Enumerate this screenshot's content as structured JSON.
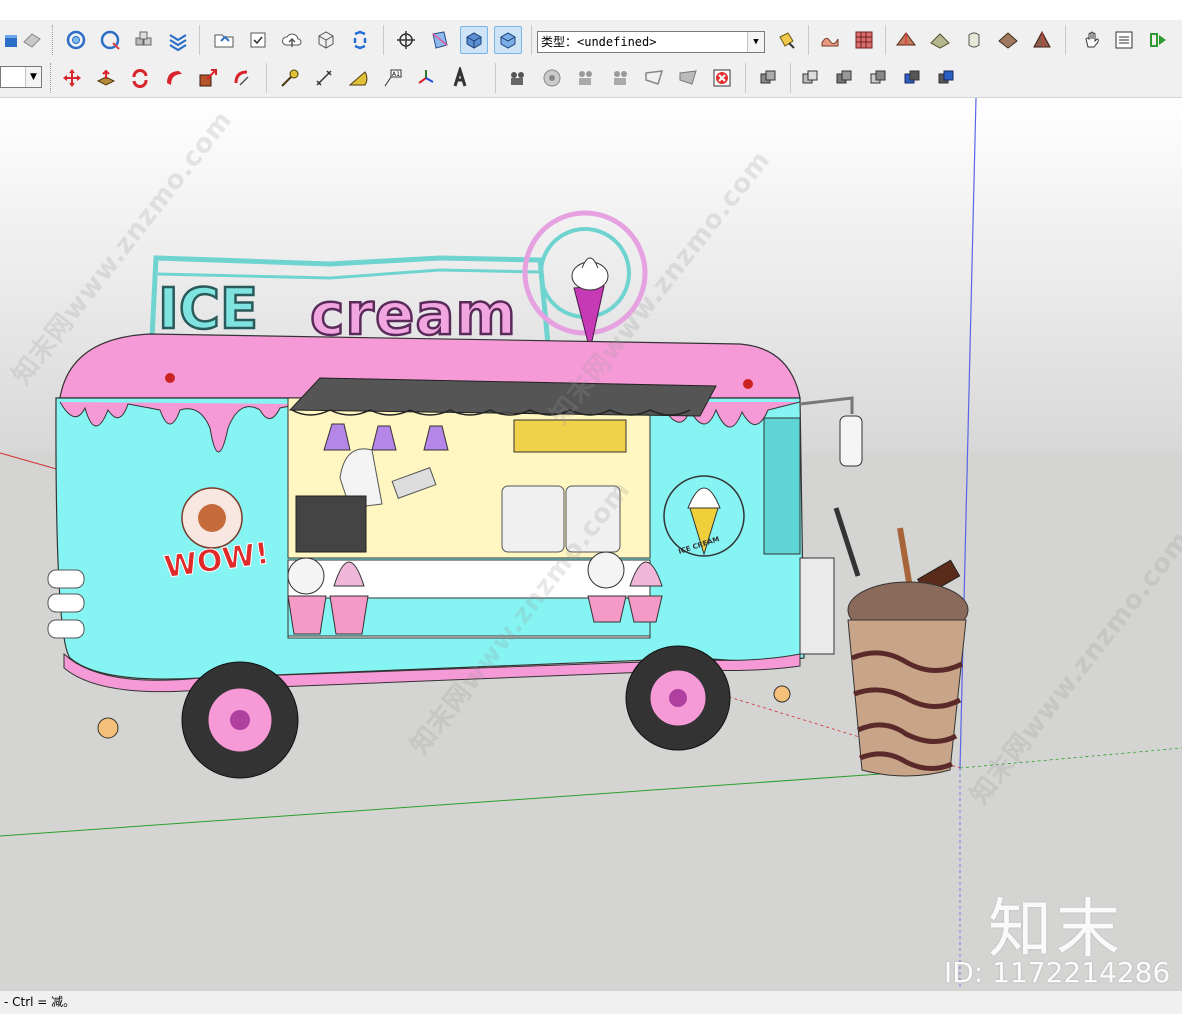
{
  "toolbar": {
    "type_field_value": "类型：<undefined>",
    "row1_icons": [
      "select-face-icon",
      "eraser-icon",
      "orbit-pan-icon",
      "orbit-zoom-icon",
      "components-icon",
      "flip-icon",
      "open-folder-icon",
      "checkbox-icon",
      "cloud-upload-icon",
      "package-icon",
      "extension-icon",
      "move-position-icon",
      "section-box-icon",
      "iso-view-icon",
      "top-view-icon",
      "paint-bucket-icon",
      "grid-tile-icon",
      "sandbox-icon",
      "terrain-icon",
      "stamp-icon",
      "texture-icon",
      "pyramid-icon",
      "hand-icon",
      "list-icon",
      "export-icon"
    ],
    "row2_icons": [
      "move-icon",
      "pushpull-icon",
      "rotate-icon",
      "followme-icon",
      "scale-icon",
      "offset-icon",
      "tape-measure-icon",
      "dimension-icon",
      "protractor-icon",
      "text-icon",
      "axes-icon",
      "3d-text-icon",
      "camera-icon",
      "look-around-icon",
      "walk-icon",
      "position-camera-icon",
      "section-plane-icon",
      "section-fill-icon",
      "delete-section-icon",
      "solid-union-icon",
      "solid-outer-shell-icon",
      "solid-intersect-icon",
      "solid-subtract-icon",
      "solid-trim-icon",
      "solid-split-icon"
    ]
  },
  "scene": {
    "sign_text": "ice cream",
    "emblem_text": "ICE CREAM",
    "wow_text": "WOW!",
    "colors": {
      "body_blue": "#85f4f2",
      "roof_pink": "#f59ad6",
      "sign_teal": "#7fe3df",
      "sign_pink": "#f2a6df",
      "ground": "#d4d4d2",
      "sky_top": "#ffffff",
      "sky_bottom": "#d8d8d8"
    }
  },
  "watermark": {
    "repeat_text": "知末网www.znzmo.com",
    "brand": "知末",
    "id_label": "ID: 1172214286"
  },
  "status": {
    "hint": "- Ctrl = 减。"
  }
}
